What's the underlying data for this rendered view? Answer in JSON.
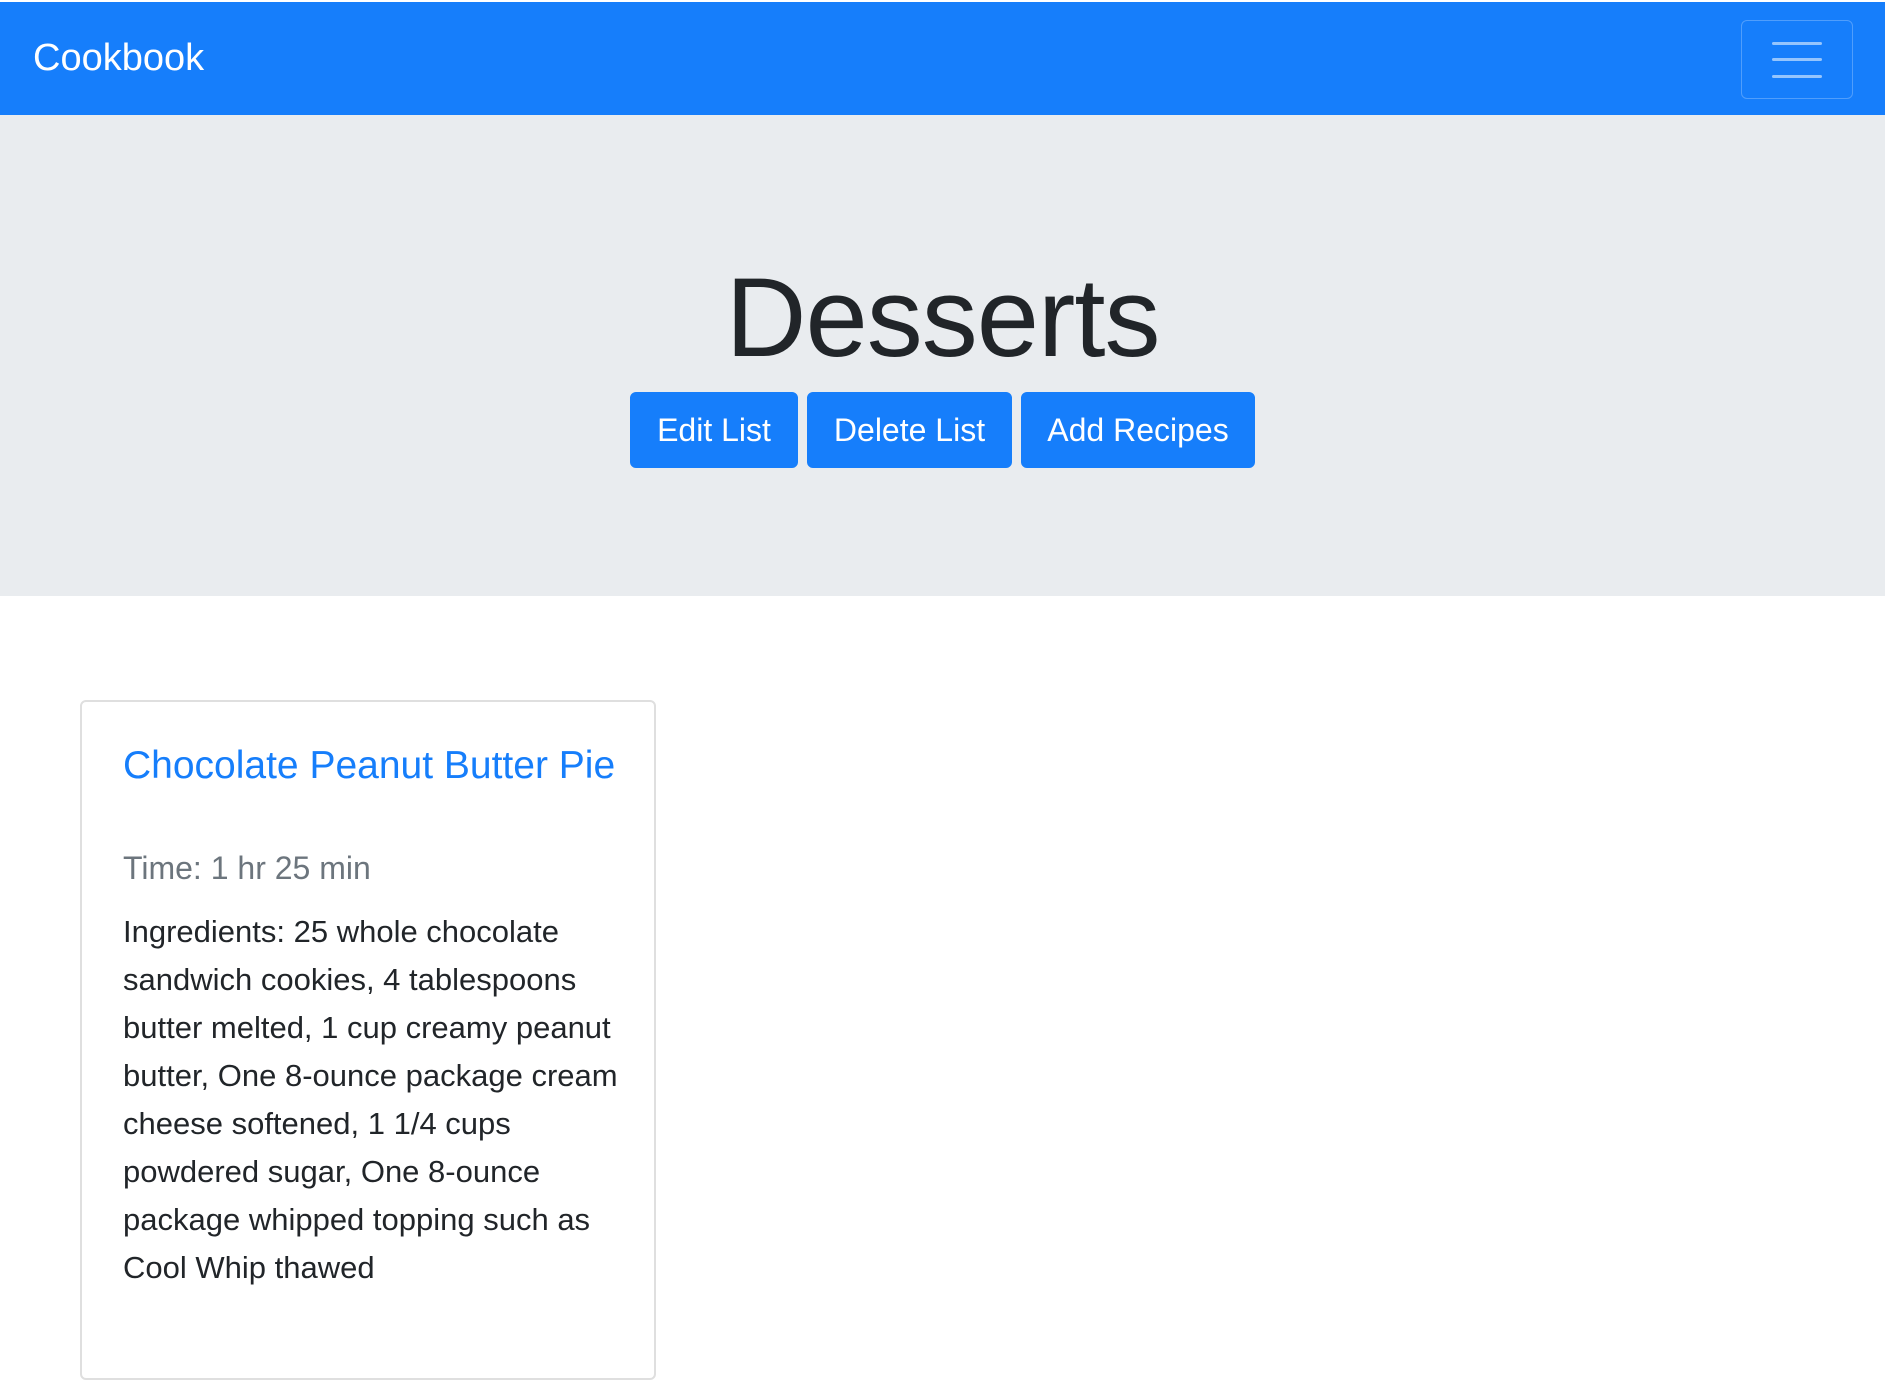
{
  "navbar": {
    "brand": "Cookbook",
    "toggler_icon": "hamburger-menu-icon",
    "background_color": "#167efb"
  },
  "list": {
    "title": "Desserts",
    "buttons": {
      "edit": "Edit List",
      "delete": "Delete List",
      "add": "Add Recipes"
    },
    "background_color": "#e9ecef"
  },
  "recipes": [
    {
      "title": "Chocolate Peanut Butter Pie",
      "time": "Time: 1 hr 25 min",
      "ingredients": "Ingredients: 25 whole chocolate sandwich cookies, 4 tablespoons butter melted, 1 cup creamy peanut butter, One 8-ounce package cream cheese softened, 1 1/4 cups powdered sugar, One 8-ounce package whipped topping such as Cool Whip thawed"
    }
  ],
  "colors": {
    "primary": "#167efb",
    "muted_text": "#6c757d",
    "body_text": "#212529"
  }
}
